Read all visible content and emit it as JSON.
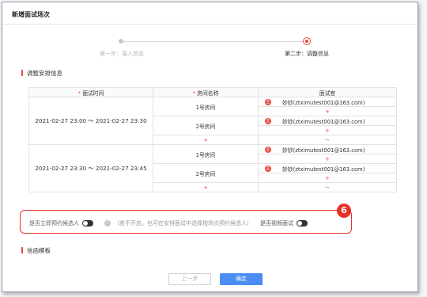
{
  "dialog": {
    "title": "新增面试场次"
  },
  "steps": {
    "step1_label": "第一步：录入信息",
    "step2_label": "第二步：调整信息"
  },
  "sections": {
    "arrange": "调整安排信息",
    "letter": "信函模板"
  },
  "table": {
    "headers": {
      "time": "面试时间",
      "room": "房间名称",
      "examiner": "面试官",
      "required_mark": "*"
    },
    "groups": [
      {
        "time": "2021-02-27 23:00 ～ 2021-02-27 23:30",
        "rooms": [
          {
            "name": "1号房间",
            "examiner_tag": "主",
            "examiner": "妙妙(ztximutest001@163.com)",
            "add": "+"
          },
          {
            "name": "2号房间",
            "examiner_tag": "主",
            "examiner": "妙妙(ztximutest001@163.com)",
            "add": "+"
          }
        ],
        "add_room": "+",
        "empty": "--"
      },
      {
        "time": "2021-02-27 23:30 ～ 2021-02-27 23:45",
        "rooms": [
          {
            "name": "1号房间",
            "examiner_tag": "主",
            "examiner": "妙妙(ztximutest001@163.com)",
            "add": "+"
          },
          {
            "name": "2号房间",
            "examiner_tag": "主",
            "examiner": "妙妙(ztximutest001@163.com)",
            "add": "+"
          }
        ],
        "add_room": "+",
        "empty": "--"
      }
    ]
  },
  "options": {
    "reserve_label": "是否立即预约候选人",
    "help_glyph": "?",
    "hint": "（若不开启，也可在安排面试中选择按场次预约候选人）",
    "video_label": "是否视频面试"
  },
  "annotation": {
    "badge": "6"
  },
  "buttons": {
    "prev": "上一步",
    "ok": "确定"
  },
  "colors": {
    "accent": "#e84a3e",
    "primary": "#4b8cf5",
    "highlight": "#e8312a"
  }
}
